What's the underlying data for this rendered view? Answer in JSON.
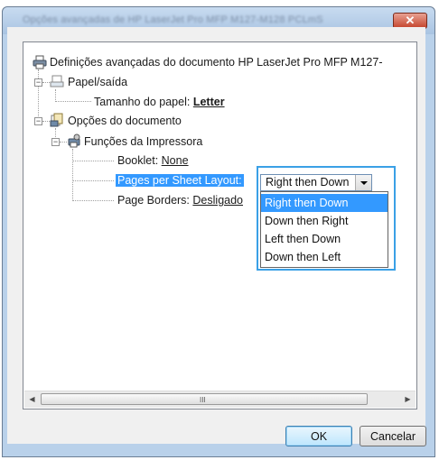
{
  "window": {
    "title": "Opções avançadas de HP LaserJet Pro MFP M127-M128 PCLmS",
    "close_glyph": "✕"
  },
  "tree": {
    "root_label": "Definições avançadas do documento HP LaserJet Pro MFP M127-",
    "paper_output": "Papel/saída",
    "paper_size_label": "Tamanho do papel:",
    "paper_size_value": "Letter",
    "document_options": "Opções do documento",
    "printer_features": "Funções da Impressora",
    "booklet_label": "Booklet:",
    "booklet_value": "None",
    "pages_layout_label": "Pages per Sheet Layout:",
    "page_borders_label": "Page Borders:",
    "page_borders_value": "Desligado",
    "expander_minus": "−"
  },
  "layout_select": {
    "selected": "Right then Down",
    "options": [
      "Right then Down",
      "Down then Right",
      "Left then Down",
      "Down then Left"
    ]
  },
  "scrollbar": {
    "left_arrow": "◀",
    "right_arrow": "▶",
    "grip": "III"
  },
  "buttons": {
    "ok": "OK",
    "cancel": "Cancelar"
  },
  "colors": {
    "selection": "#3399ff",
    "highlight_frame": "#3aa0e6"
  }
}
